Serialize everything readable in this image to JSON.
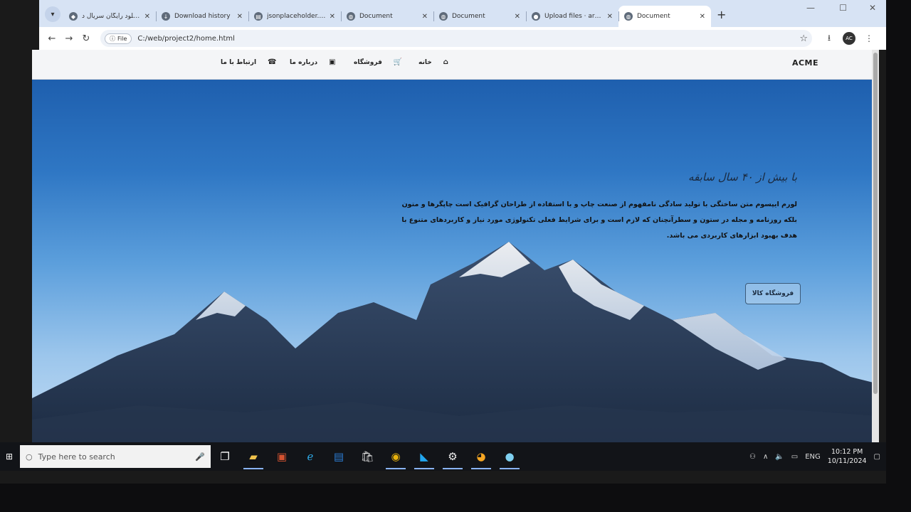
{
  "browser": {
    "tabs": [
      {
        "label": "دانلود رایگان سریال د...",
        "icon": "site-icon"
      },
      {
        "label": "Download history",
        "icon": "download-icon"
      },
      {
        "label": "jsonplaceholder.typic",
        "icon": "page-icon"
      },
      {
        "label": "Document",
        "icon": "globe-icon"
      },
      {
        "label": "Document",
        "icon": "globe-icon"
      },
      {
        "label": "Upload files · argmen",
        "icon": "github-icon"
      },
      {
        "label": "Document",
        "icon": "globe-icon",
        "active": true
      }
    ],
    "address": {
      "chip": "File",
      "url": "C:/web/project2/home.html"
    }
  },
  "site": {
    "brand": "ACME",
    "nav": [
      {
        "label": "خانه",
        "icon": "home-icon"
      },
      {
        "label": "فروشگاه",
        "icon": "basket-icon"
      },
      {
        "label": "درباره ما",
        "icon": "contact-card-icon"
      },
      {
        "label": "ارتباط با ما",
        "icon": "phone-icon"
      }
    ],
    "hero": {
      "title": "با بیش از ۴۰ سال سابقه",
      "text": "لورم ایپسوم متن ساختگی با تولید سادگی نامفهوم از صنعت چاپ و با استفاده از طراحان گرافیک است چاپگرها و متون بلکه روزنامه و مجله در ستون و سطرآنچنان که لازم است و برای شرایط فعلی تکنولوژی مورد نیاز و کاربردهای متنوع با هدف بهبود ابزارهای کاربردی می باشد.",
      "button": "فروشگاه کالا"
    }
  },
  "taskbar": {
    "search_placeholder": "Type here to search",
    "apps": [
      "task-view-icon",
      "file-explorer-icon",
      "powerpoint-icon",
      "edge-icon",
      "word-icon",
      "store-icon",
      "chrome-icon",
      "vscode-icon",
      "settings-icon",
      "paint-icon",
      "app-icon"
    ],
    "lang": "ENG",
    "time": "10:12 PM",
    "date": "10/11/2024"
  }
}
